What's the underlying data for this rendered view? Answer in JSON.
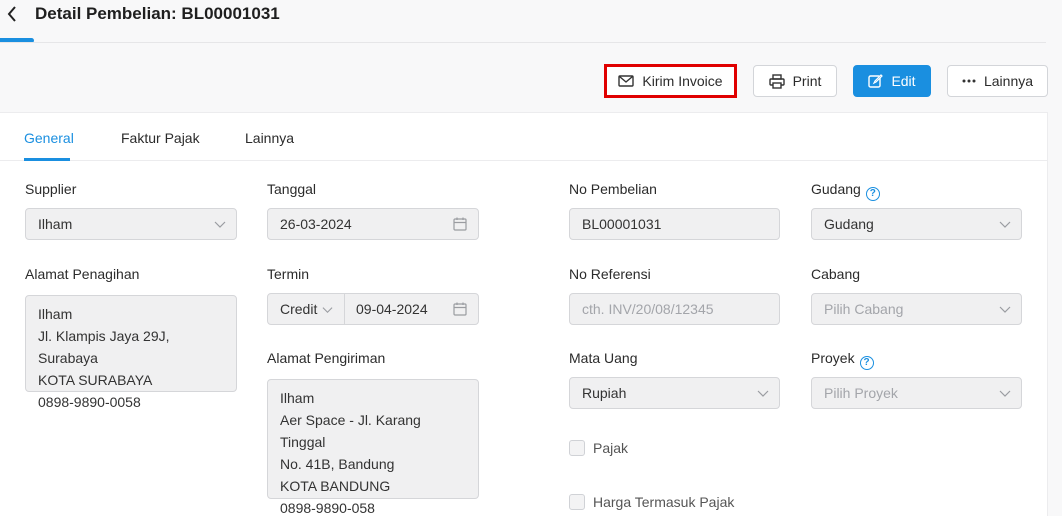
{
  "header": {
    "title": "Detail Pembelian: BL00001031"
  },
  "actions": {
    "kirim": "Kirim Invoice",
    "print": "Print",
    "edit": "Edit",
    "more": "Lainnya"
  },
  "tabs": [
    "General",
    "Faktur Pajak",
    "Lainnya"
  ],
  "form": {
    "supplier": {
      "label": "Supplier",
      "value": "Ilham"
    },
    "tanggal": {
      "label": "Tanggal",
      "value": "26-03-2024"
    },
    "no_pembelian": {
      "label": "No Pembelian",
      "value": "BL00001031"
    },
    "gudang": {
      "label": "Gudang",
      "value": "Gudang"
    },
    "alamat_penagihan": {
      "label": "Alamat Penagihan",
      "lines": [
        "Ilham",
        "Jl. Klampis Jaya 29J, Surabaya",
        "KOTA SURABAYA",
        "0898-9890-0058"
      ]
    },
    "termin": {
      "label": "Termin",
      "value": "Credit",
      "date": "09-04-2024"
    },
    "no_referensi": {
      "label": "No Referensi",
      "placeholder": "cth. INV/20/08/12345"
    },
    "cabang": {
      "label": "Cabang",
      "placeholder": "Pilih Cabang"
    },
    "alamat_pengiriman": {
      "label": "Alamat Pengiriman",
      "lines": [
        "Ilham",
        "Aer Space - Jl. Karang Tinggal",
        "No. 41B, Bandung",
        "KOTA BANDUNG",
        "0898-9890-058"
      ]
    },
    "mata_uang": {
      "label": "Mata Uang",
      "value": "Rupiah"
    },
    "proyek": {
      "label": "Proyek",
      "placeholder": "Pilih Proyek"
    },
    "pajak": {
      "label": "Pajak"
    },
    "harga_pajak": {
      "label": "Harga Termasuk Pajak"
    }
  },
  "colors": {
    "accent": "#1a8fe0",
    "highlight": "#e00000"
  }
}
